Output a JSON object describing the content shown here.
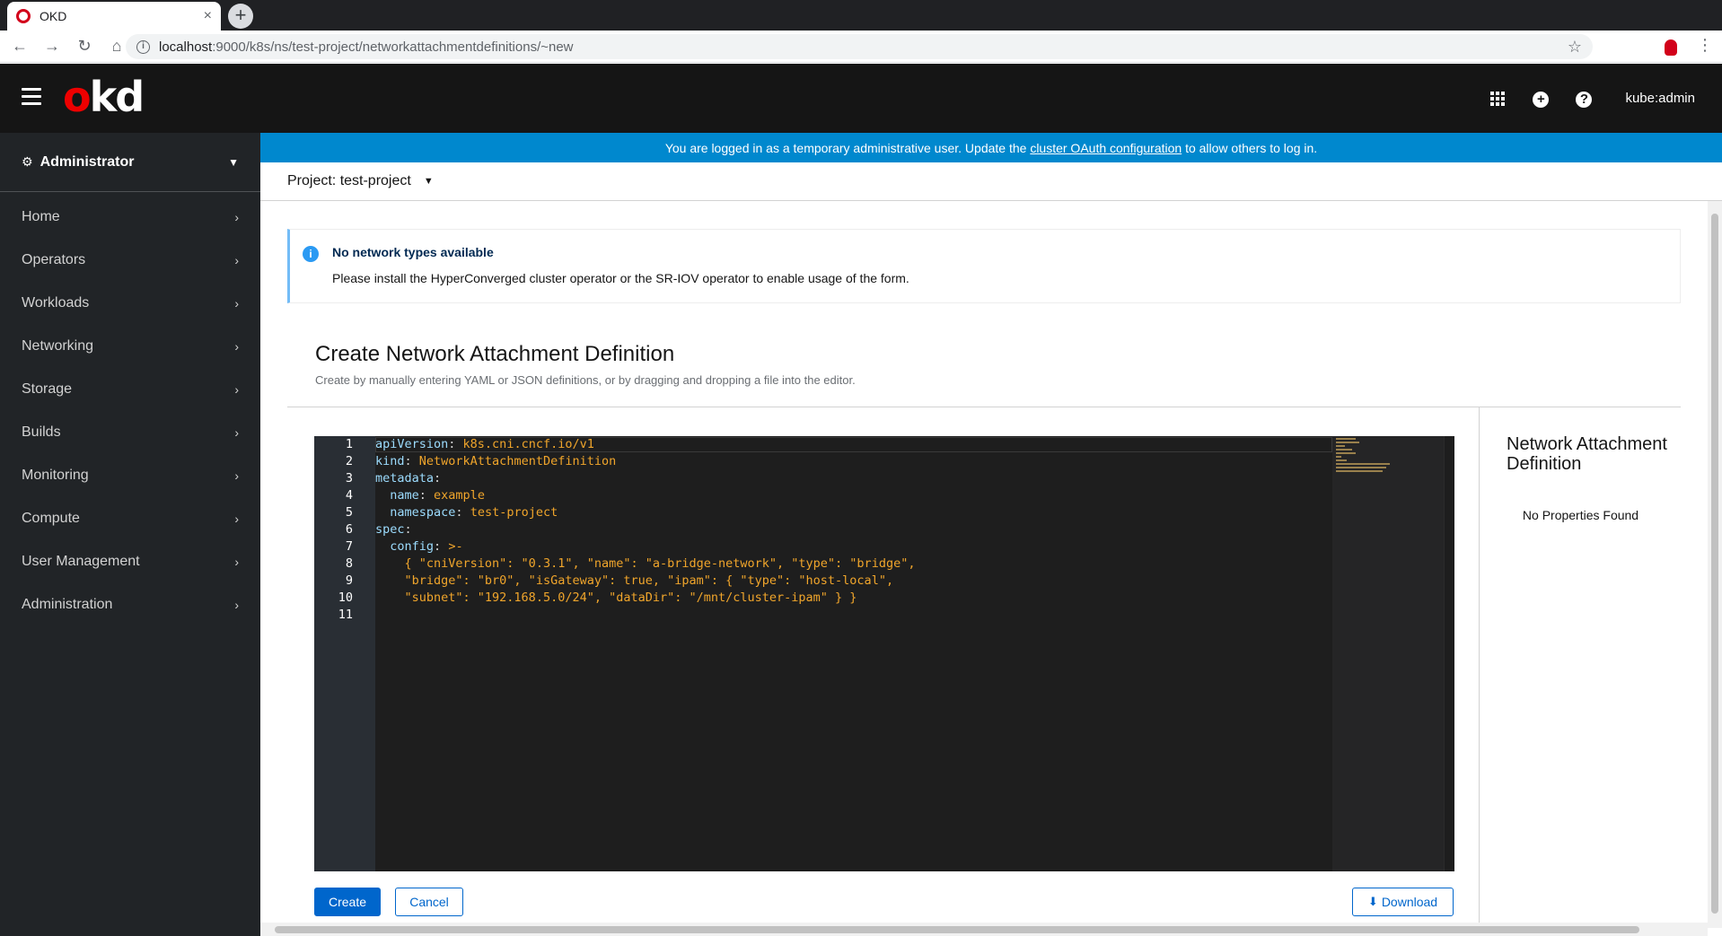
{
  "browser": {
    "tab_title": "OKD",
    "tab_close": "×",
    "new_tab": "+",
    "url_host": "localhost",
    "url_path": ":9000/k8s/ns/test-project/networkattachmentdefinitions/~new",
    "back": "←",
    "forward": "→",
    "reload": "↻",
    "home": "⌂",
    "star": "☆",
    "menu": "⋮"
  },
  "masthead": {
    "logo_o": "o",
    "logo_rest": "kd",
    "user": "kube:admin",
    "help": "?",
    "add": "+"
  },
  "sidebar": {
    "perspective": "Administrator",
    "items": [
      {
        "label": "Home"
      },
      {
        "label": "Operators"
      },
      {
        "label": "Workloads"
      },
      {
        "label": "Networking"
      },
      {
        "label": "Storage"
      },
      {
        "label": "Builds"
      },
      {
        "label": "Monitoring"
      },
      {
        "label": "Compute"
      },
      {
        "label": "User Management"
      },
      {
        "label": "Administration"
      }
    ]
  },
  "banner": {
    "prefix": "You are logged in as a temporary administrative user. Update the ",
    "link": "cluster OAuth configuration",
    "suffix": " to allow others to log in."
  },
  "project": {
    "label": "Project: test-project"
  },
  "alert": {
    "icon": "i",
    "title": "No network types available",
    "body": "Please install the HyperConverged cluster operator or the SR-IOV operator to enable usage of the form."
  },
  "page": {
    "title": "Create Network Attachment Definition",
    "description": "Create by manually entering YAML or JSON definitions, or by dragging and dropping a file into the editor."
  },
  "editor": {
    "line_numbers": [
      "1",
      "2",
      "3",
      "4",
      "5",
      "6",
      "7",
      "8",
      "9",
      "10",
      "11"
    ],
    "lines": [
      {
        "indent": "",
        "key": "apiVersion",
        "sep": ": ",
        "value": "k8s.cni.cncf.io/v1"
      },
      {
        "indent": "",
        "key": "kind",
        "sep": ": ",
        "value": "NetworkAttachmentDefinition"
      },
      {
        "indent": "",
        "key": "metadata",
        "sep": ":",
        "value": ""
      },
      {
        "indent": "  ",
        "key": "name",
        "sep": ": ",
        "value": "example"
      },
      {
        "indent": "  ",
        "key": "namespace",
        "sep": ": ",
        "value": "test-project"
      },
      {
        "indent": "",
        "key": "spec",
        "sep": ":",
        "value": ""
      },
      {
        "indent": "  ",
        "key": "config",
        "sep": ": ",
        "value": ">-"
      },
      {
        "indent": "    ",
        "key": "",
        "sep": "",
        "value": "{ \"cniVersion\": \"0.3.1\", \"name\": \"a-bridge-network\", \"type\": \"bridge\","
      },
      {
        "indent": "    ",
        "key": "",
        "sep": "",
        "value": "\"bridge\": \"br0\", \"isGateway\": true, \"ipam\": { \"type\": \"host-local\","
      },
      {
        "indent": "    ",
        "key": "",
        "sep": "",
        "value": "\"subnet\": \"192.168.5.0/24\", \"dataDir\": \"/mnt/cluster-ipam\" } }"
      },
      {
        "indent": "",
        "key": "",
        "sep": "",
        "value": ""
      }
    ]
  },
  "sidepanel": {
    "title": "Network Attachment Definition",
    "empty": "No Properties Found"
  },
  "actions": {
    "create": "Create",
    "cancel": "Cancel",
    "download": "Download"
  }
}
